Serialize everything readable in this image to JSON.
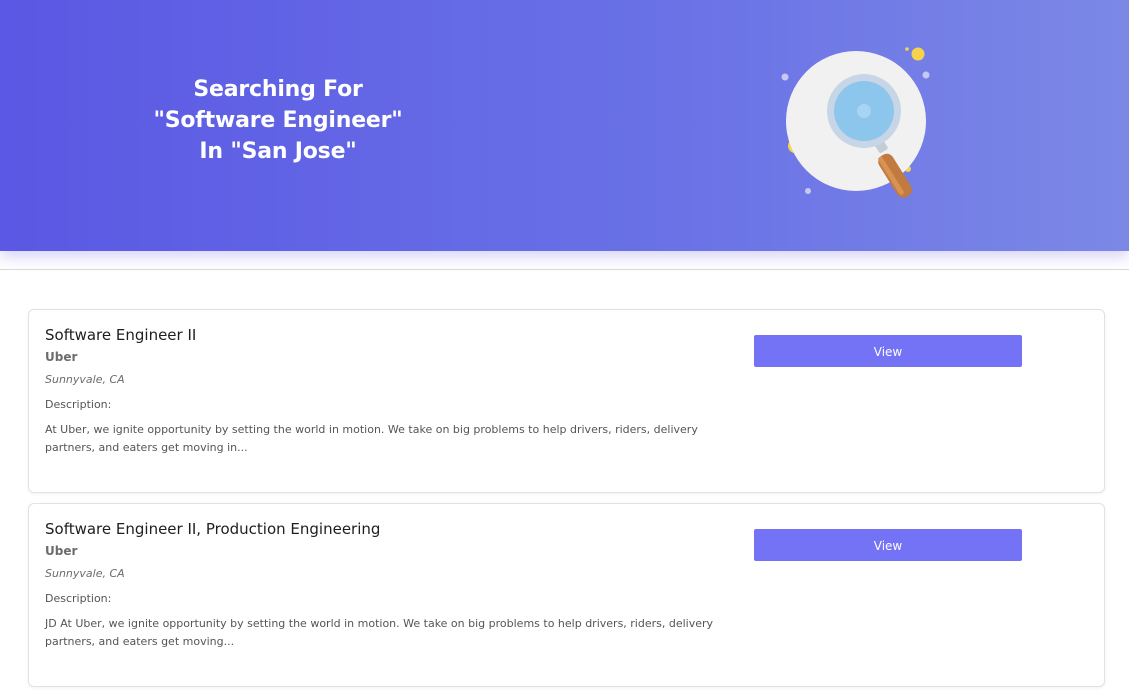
{
  "hero": {
    "title_line1": "Searching For",
    "title_line2": "\"Software Engineer\"",
    "title_line3": "In \"San Jose\""
  },
  "colors": {
    "hero_gradient_start": "#5a58e4",
    "hero_gradient_end": "#7c88e6",
    "button": "#7472f5"
  },
  "illustration": {
    "icon": "magnifying-glass-icon"
  },
  "jobs": [
    {
      "title": "Software Engineer II",
      "company": "Uber",
      "location": "Sunnyvale, CA",
      "description_label": "Description:",
      "description": "At Uber, we ignite opportunity by setting the world in motion. We take on big problems to help drivers, riders, delivery partners, and eaters get moving in...",
      "button_label": "View"
    },
    {
      "title": "Software Engineer II, Production Engineering",
      "company": "Uber",
      "location": "Sunnyvale, CA",
      "description_label": "Description:",
      "description": "JD At Uber, we ignite opportunity by setting the world in motion. We take on big problems to help drivers, riders, delivery partners, and eaters get moving...",
      "button_label": "View"
    }
  ]
}
